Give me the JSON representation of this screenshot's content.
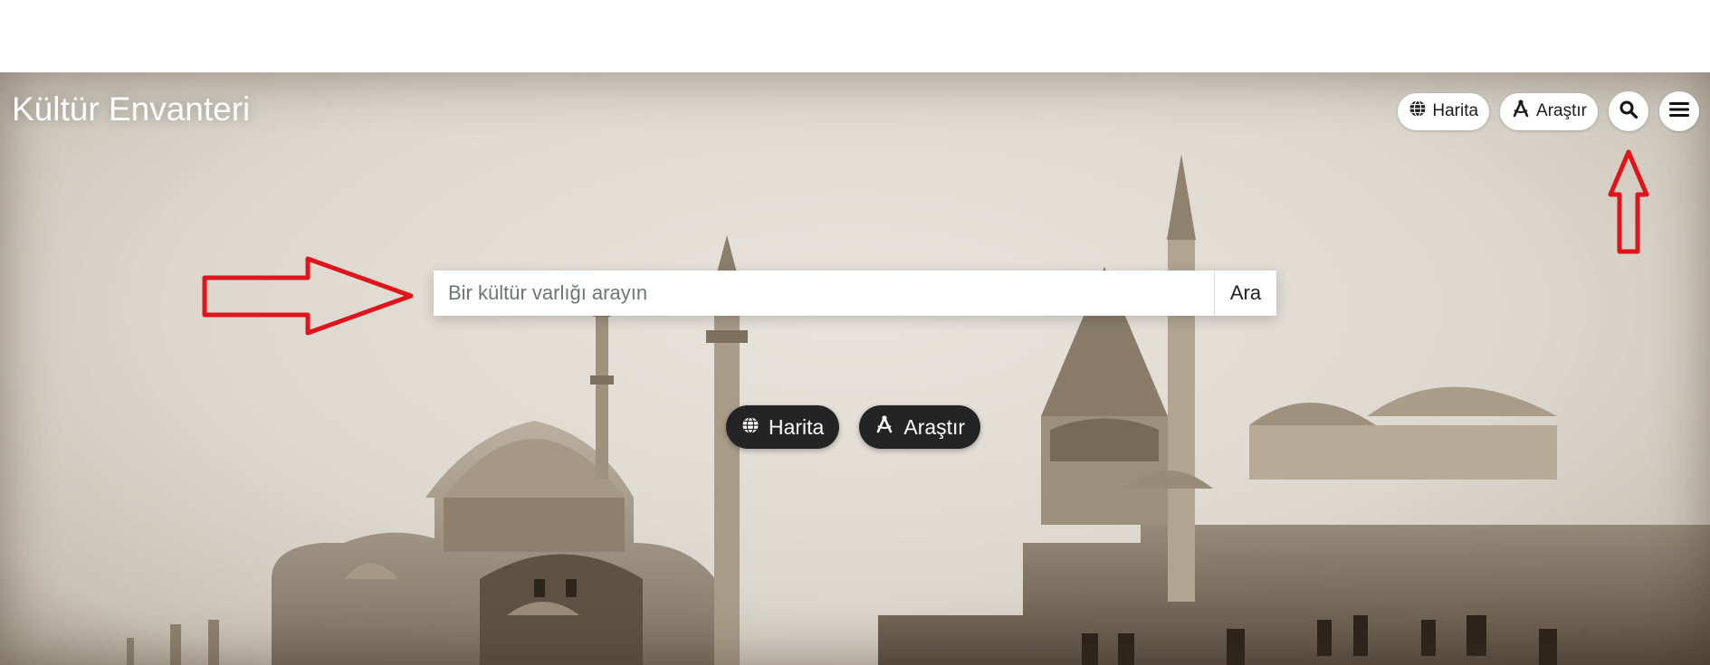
{
  "header": {
    "brand": "Kültür Envanteri",
    "nav": {
      "map_label": "Harita",
      "explore_label": "Araştır",
      "search_icon": "search-icon",
      "menu_icon": "hamburger-menu-icon"
    }
  },
  "search": {
    "placeholder": "Bir kültür varlığı arayın",
    "value": "",
    "button_label": "Ara"
  },
  "hero_actions": {
    "map_label": "Harita",
    "explore_label": "Araştır"
  },
  "annotations": {
    "arrow_color": "#e0141b"
  },
  "colors": {
    "dark_pill": "#242424",
    "light_pill": "#ffffff"
  }
}
